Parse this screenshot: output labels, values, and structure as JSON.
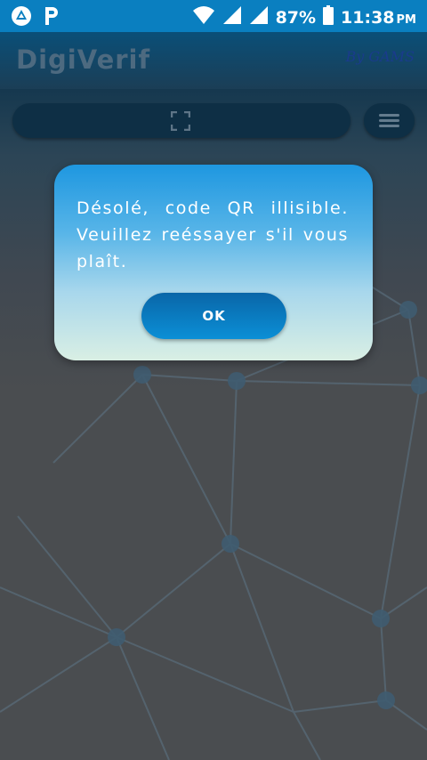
{
  "status_bar": {
    "battery_percent": "87%",
    "time": "11:38",
    "am_pm": "PM",
    "left_icons": [
      "drive-style-notification-icon",
      "parking-p-icon"
    ],
    "right_icons": [
      "wifi-icon",
      "cellular-signal-icon",
      "cellular-signal-2-icon",
      "battery-icon"
    ]
  },
  "app_bar": {
    "title": "DigiVerif",
    "signature": "By GAMS"
  },
  "toolbar": {
    "scan_icon": "qr-scan-frame-icon",
    "menu_icon": "hamburger-menu-icon"
  },
  "dialog": {
    "message": "Désolé, code QR illisible. Veuillez reéssayer s'il vous plaît.",
    "ok_label": "OK"
  },
  "colors": {
    "status_bar": "#0a7fc0",
    "dialog_top": "#1e97e0",
    "dialog_bottom": "#d9efe4",
    "ok_button": "#0b8fd6",
    "overlay": "#4a4d50"
  }
}
